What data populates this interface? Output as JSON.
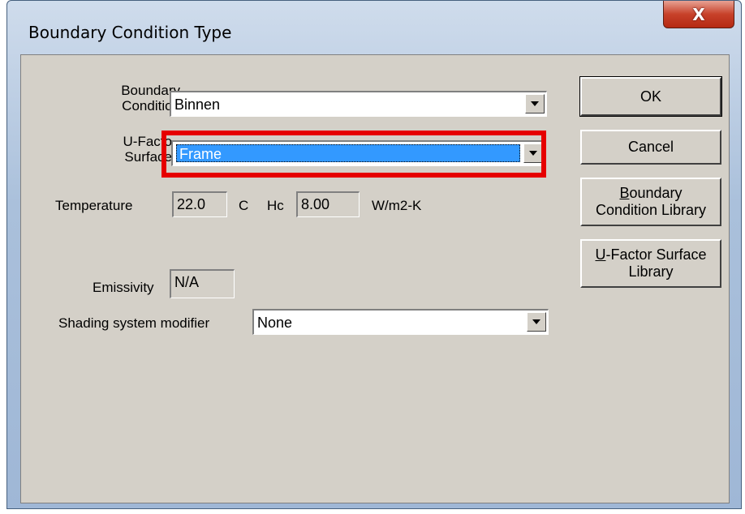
{
  "window": {
    "title": "Boundary Condition Type",
    "close_label": "X"
  },
  "fields": {
    "boundary_condition": {
      "label_line1": "Boundary",
      "label_line2": "Condition",
      "value": "Binnen"
    },
    "ufactor_surface": {
      "label_line1": "U-Facto",
      "label_line2": "Surface",
      "value": "Frame"
    },
    "temperature": {
      "label": "Temperature",
      "value": "22.0",
      "unit": "C"
    },
    "hc": {
      "label": "Hc",
      "value": "8.00",
      "unit": "W/m2-K"
    },
    "emissivity": {
      "label": "Emissivity",
      "value": "N/A"
    },
    "shading": {
      "label": "Shading system modifier",
      "value": "None"
    }
  },
  "buttons": {
    "ok": "OK",
    "cancel": "Cancel",
    "bc_library_line1_rest": "oundary",
    "bc_library_line1_accel": "B",
    "bc_library_line2": "Condition Library",
    "uf_library_line1_accel": "U",
    "uf_library_line1_rest": "-Factor Surface",
    "uf_library_line2": "Library"
  },
  "colors": {
    "highlight": "#e60000",
    "selection": "#3399ff",
    "dialog_face": "#d4d0c8"
  },
  "icons": {
    "dropdown": "chevron-down-icon",
    "close": "close-icon"
  }
}
